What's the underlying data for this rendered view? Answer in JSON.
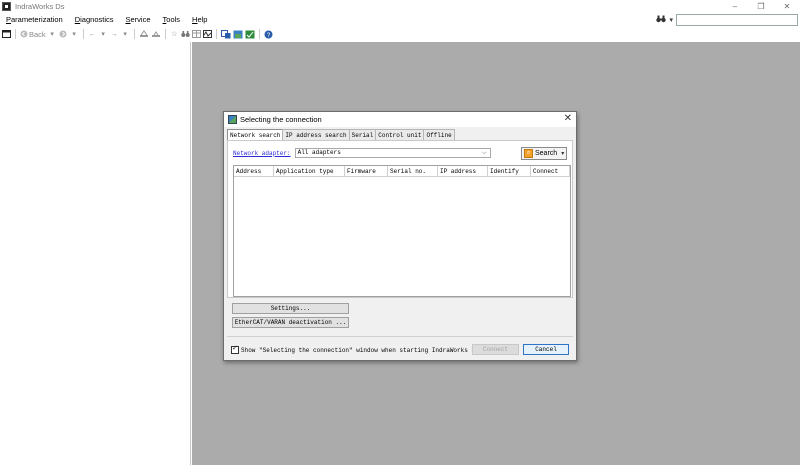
{
  "app": {
    "title": "IndraWorks Ds",
    "window_controls": [
      "–",
      "❐",
      "✕"
    ]
  },
  "menubar": {
    "items": [
      {
        "underline": "P",
        "rest": "arameterization"
      },
      {
        "underline": "D",
        "rest": "iagnostics"
      },
      {
        "underline": "S",
        "rest": "ervice"
      },
      {
        "underline": "T",
        "rest": "ools"
      },
      {
        "underline": "H",
        "rest": "elp"
      }
    ],
    "search_icon": "binoculars-icon",
    "search_dropdown": "▾",
    "search_value": ""
  },
  "toolbar": {
    "back_label": "Back"
  },
  "dialog": {
    "title": "Selecting the connection",
    "close_glyph": "✕",
    "tabs": [
      {
        "label": "Network search",
        "active": true
      },
      {
        "label": "IP address search",
        "active": false
      },
      {
        "label": "Serial",
        "active": false
      },
      {
        "label": "Control unit",
        "active": false
      },
      {
        "label": "Offline",
        "active": false
      }
    ],
    "adapter_label": "Network adapter:",
    "adapter_value": "All adapters",
    "search_button": "Search",
    "columns": [
      "Address",
      "Application type",
      "Firmware",
      "Serial no.",
      "IP address",
      "Identify",
      "Connect"
    ],
    "settings_button": "Settings...",
    "ethercat_button": "EtherCAT/VARAN deactivation ...",
    "show_checkbox_label": "Show \"Selecting the connection\" window when starting IndraWorks Ds",
    "show_checked": true,
    "connect_button": "Connect",
    "cancel_button": "Cancel"
  }
}
